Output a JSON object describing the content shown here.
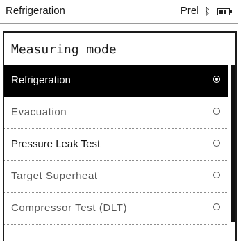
{
  "status_bar": {
    "app_title": "Refrigeration",
    "status_text": "Prel",
    "bluetooth_icon": "bluetooth-icon",
    "battery_icon": "battery-icon"
  },
  "panel": {
    "title": "Measuring mode",
    "items": [
      {
        "label": "Refrigeration",
        "selected": true
      },
      {
        "label": "Evacuation",
        "selected": false
      },
      {
        "label": "Pressure Leak Test",
        "selected": false
      },
      {
        "label": "Target Superheat",
        "selected": false
      },
      {
        "label": "Compressor Test (DLT)",
        "selected": false
      }
    ]
  },
  "colors": {
    "selected_background": "#000000",
    "selected_text": "#ffffff",
    "text": "#1a1a1a",
    "separator": "#8c8c8c"
  }
}
